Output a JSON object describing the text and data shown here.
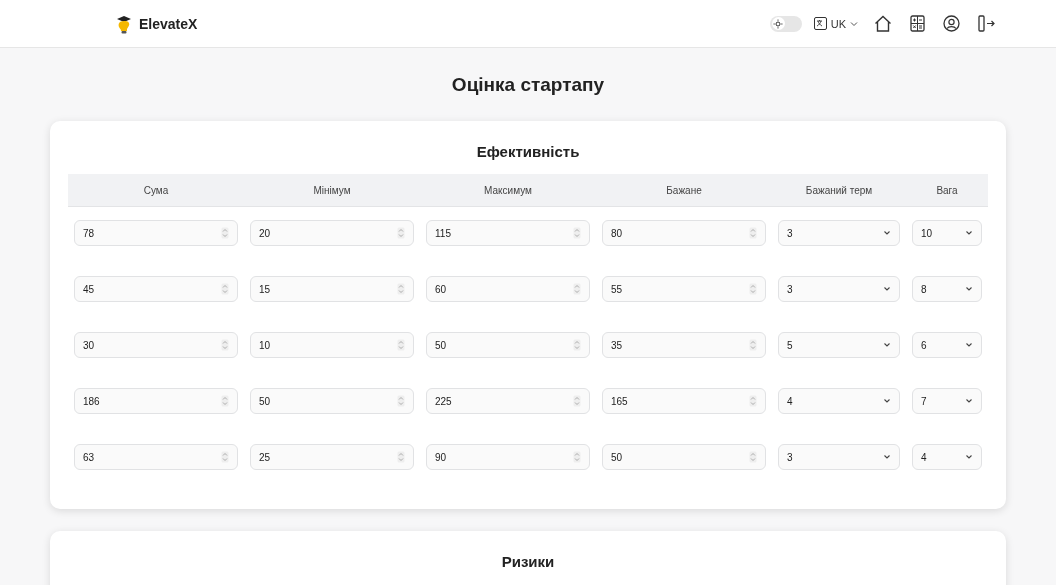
{
  "header": {
    "logo": "ElevateX",
    "theme_toggle": {
      "on": false
    },
    "language": "UK"
  },
  "page_title": "Оцінка стартапу",
  "efficiency": {
    "title": "Ефективність",
    "columns": [
      "Сума",
      "Мінімум",
      "Максимум",
      "Бажане",
      "Бажаний терм",
      "Вага"
    ],
    "rows": [
      {
        "values": [
          "78",
          "20",
          "115",
          "80"
        ],
        "term": "3",
        "weight": "10"
      },
      {
        "values": [
          "45",
          "15",
          "60",
          "55"
        ],
        "term": "3",
        "weight": "8"
      },
      {
        "values": [
          "30",
          "10",
          "50",
          "35"
        ],
        "term": "5",
        "weight": "6"
      },
      {
        "values": [
          "186",
          "50",
          "225",
          "165"
        ],
        "term": "4",
        "weight": "7"
      },
      {
        "values": [
          "63",
          "25",
          "90",
          "50"
        ],
        "term": "3",
        "weight": "4"
      }
    ]
  },
  "risks": {
    "title": "Ризики"
  }
}
